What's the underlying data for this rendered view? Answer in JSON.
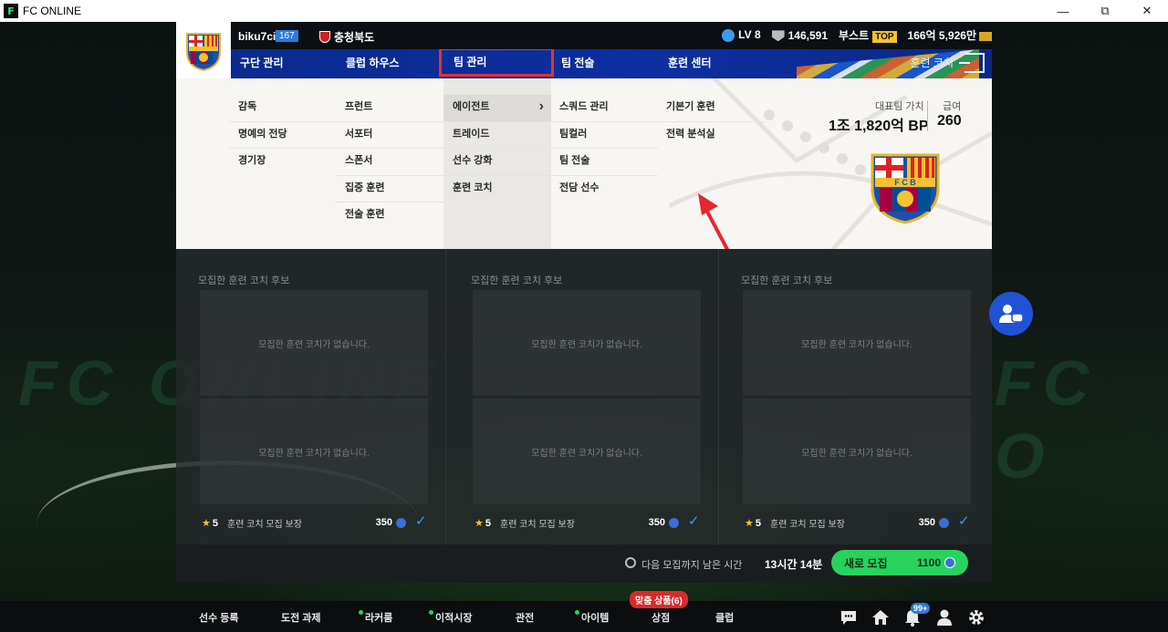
{
  "window": {
    "title": "FC ONLINE"
  },
  "header": {
    "username": "biku7cii",
    "level_badge": "167",
    "region": "충청북도",
    "lv": "LV 8",
    "bp": "146,591",
    "boost_label": "부스트",
    "boost_tag": "TOP",
    "money": "166억 5,926만"
  },
  "nav": {
    "items": [
      "구단 관리",
      "클럽 하우스",
      "팀 관리",
      "팀 전술",
      "훈련 센터"
    ],
    "active_index": 2,
    "right_label": "훈련 코치"
  },
  "dropdown": {
    "col1": [
      "감독",
      "명예의 전당",
      "경기장"
    ],
    "col2": [
      "프런트",
      "서포터",
      "스폰서",
      "집중 훈련",
      "전술 훈련"
    ],
    "col3": [
      "에이전트",
      "트레이드",
      "선수 강화",
      "훈련 코치"
    ],
    "col4": [
      "스쿼드 관리",
      "팀컬러",
      "팀 전술",
      "전담 선수"
    ],
    "col5": [
      "기본기 훈련",
      "전력 분석실"
    ],
    "rep_label": "대표팀 가치",
    "rep_value": "1조 1,820억 BP",
    "wage_label": "급여",
    "wage_value": "260"
  },
  "panels": [
    {
      "title": "모집한 훈련 코치 후보",
      "empty1": "모집한 훈련 코치가 없습니다.",
      "empty2": "모집한 훈련 코치가 없습니다.",
      "star": "★",
      "grade": "5",
      "label": "훈련 코치 모집 보장",
      "cost": "350"
    },
    {
      "title": "모집한 훈련 코치 후보",
      "empty1": "모집한 훈련 코치가 없습니다.",
      "empty2": "모집한 훈련 코치가 없습니다.",
      "star": "★",
      "grade": "5",
      "label": "훈련 코치 모집 보장",
      "cost": "350"
    },
    {
      "title": "모집한 훈련 코치 후보",
      "empty1": "모집한 훈련 코치가 없습니다.",
      "empty2": "모집한 훈련 코치가 없습니다.",
      "star": "★",
      "grade": "5",
      "label": "훈련 코치 모집 보장",
      "cost": "350"
    }
  ],
  "recruit": {
    "timer_label": "다음 모집까지 남은 시간",
    "timer_value": "13시간 14분",
    "button_label": "새로 모집",
    "button_cost": "1100"
  },
  "bottom_nav": {
    "items": [
      "선수 등록",
      "도전 과제",
      "라커룸",
      "이적시장",
      "관전",
      "아이템",
      "상점",
      "클럽"
    ],
    "shop_tag": "맞춤 상품(6)",
    "notif_count": "99+"
  },
  "colors": {
    "nav_blue": "#0d2fa0",
    "accent_green": "#27d35c",
    "highlight_red": "#e53030"
  }
}
